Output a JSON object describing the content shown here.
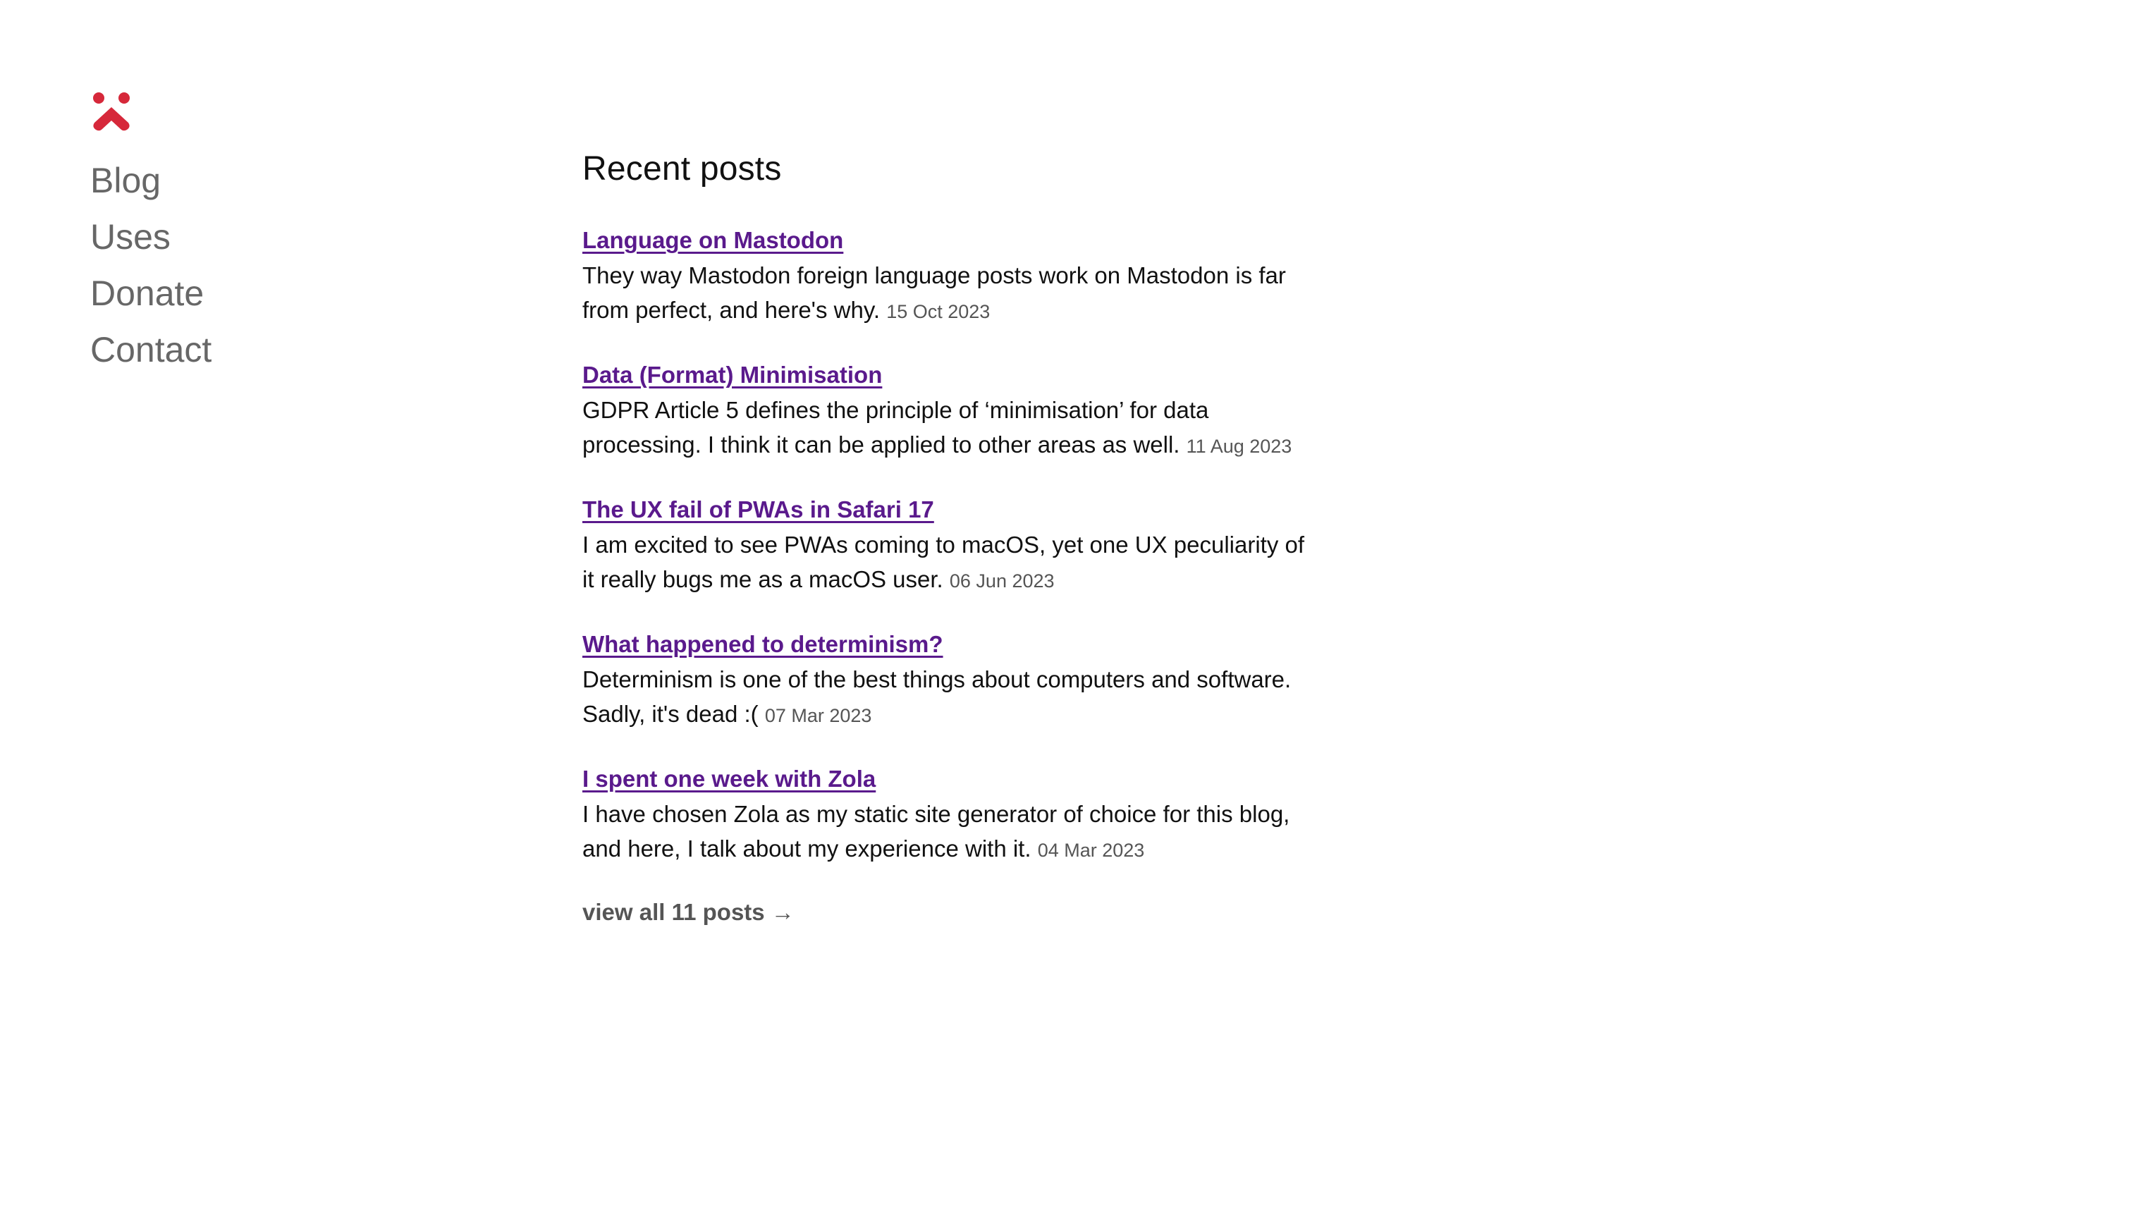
{
  "brand": {
    "logo_icon": "red-person-glyph-icon",
    "accent_color": "#d6283a"
  },
  "nav": {
    "items": [
      {
        "label": "Blog"
      },
      {
        "label": "Uses"
      },
      {
        "label": "Donate"
      },
      {
        "label": "Contact"
      }
    ]
  },
  "main": {
    "heading": "Recent posts",
    "posts": [
      {
        "title": "Language on Mastodon",
        "description": "They way Mastodon foreign language posts work on Mastodon is far from perfect, and here's why.",
        "date": "15 Oct 2023"
      },
      {
        "title": "Data (Format) Minimisation",
        "description": "GDPR Article 5 defines the principle of ‘minimisation’ for data processing. I think it can be applied to other areas as well.",
        "date": "11 Aug 2023"
      },
      {
        "title": "The UX fail of PWAs in Safari 17",
        "description": "I am excited to see PWAs coming to macOS, yet one UX peculiarity of it really bugs me as a macOS user.",
        "date": "06 Jun 2023"
      },
      {
        "title": "What happened to determinism?",
        "description": "Determinism is one of the best things about computers and software. Sadly, it's dead :(",
        "date": "07 Mar 2023"
      },
      {
        "title": "I spent one week with Zola",
        "description": "I have chosen Zola as my static site generator of choice for this blog, and here, I talk about my experience with it.",
        "date": "04 Mar 2023"
      }
    ],
    "view_all_label": "view all 11 posts",
    "view_all_arrow": "→"
  }
}
